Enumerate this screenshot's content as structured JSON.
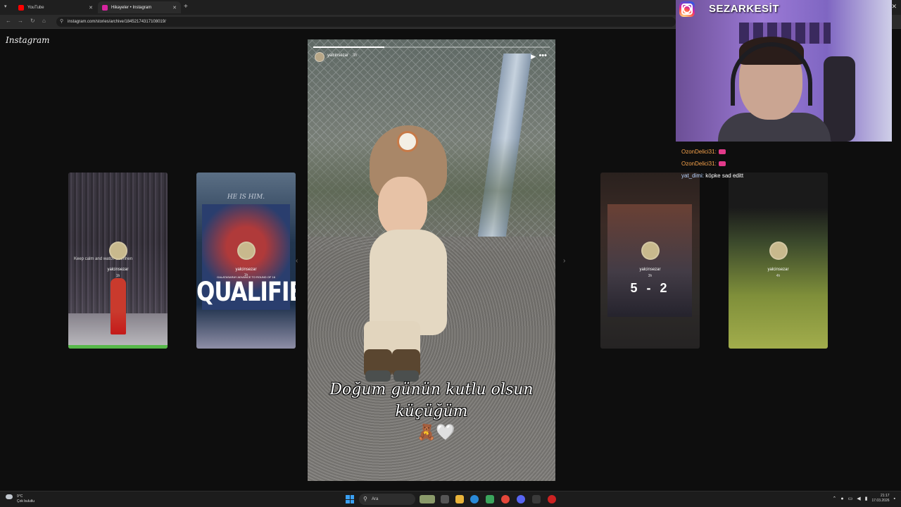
{
  "browser": {
    "tabs": [
      {
        "title": "YouTube",
        "icon": "youtube-icon",
        "color": "#ff0000"
      },
      {
        "title": "Hikayeler • Instagram",
        "icon": "instagram-icon",
        "color": "#d6249f"
      }
    ],
    "url": "instagram.com/stories/archive/18452174317108019/"
  },
  "instagram": {
    "logo": "Instagram",
    "main_story": {
      "username": "yalcinsezar",
      "time": "3h",
      "caption_line1": "Doğum günün kutlu olsun",
      "caption_line2": "küçüğüm",
      "emoji": "🧸🤍"
    },
    "side_stories": [
      {
        "username": "yalcinsezar",
        "time": "1h",
        "caption": "Keep calm and watch Osimhen"
      },
      {
        "username": "yalcinsezar",
        "time": "1h",
        "headline": "HE IS HIM.",
        "subline": "GALATASARAY ADVANCE TO ROUND OF 16",
        "title": "QUALIFIED"
      },
      {
        "username": "yalcinsezar",
        "time": "3h",
        "score": "5 - 2"
      },
      {
        "username": "yalcinsezar",
        "time": "4h"
      }
    ]
  },
  "stream": {
    "channel": "SEZARKESİT",
    "chat": [
      {
        "user": "OzonDelici31:",
        "message": ""
      },
      {
        "user": "OzonDelici31:",
        "message": ""
      },
      {
        "user": "yat_dimi:",
        "message": "köpke sad editt"
      }
    ]
  },
  "taskbar": {
    "weather_temp": "9°C",
    "weather_desc": "Çok bulutlu",
    "search_placeholder": "Ara",
    "time": "21:17",
    "date": "17.03.2026"
  }
}
